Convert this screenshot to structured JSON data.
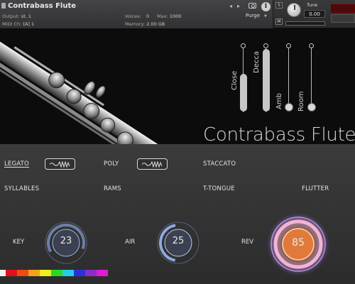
{
  "header": {
    "instrument_name": "Contrabass Flute",
    "output_label": "Output:",
    "output_value": "st. 1",
    "midi_label": "MIDI Ch:",
    "midi_value": "[A] 1",
    "voices_label": "Voices:",
    "voices_value": "0",
    "max_label": "Max:",
    "max_value": "1000",
    "memory_label": "Memory:",
    "memory_value": "2.00 GB",
    "purge_label": "Purge",
    "info_label": "i",
    "tune_label": "Tune",
    "tune_value": "0.00",
    "s_label": "S",
    "m_label": "M",
    "nav_left": "◂",
    "nav_right": "▸"
  },
  "mics": [
    {
      "name": "Close",
      "level": 0.55
    },
    {
      "name": "Decca",
      "level": 0.9
    },
    {
      "name": "Amb",
      "level": 0.0
    },
    {
      "name": "Room",
      "level": 0.0
    }
  ],
  "title": "Contrabass Flute",
  "articulations": {
    "legato": "LEGATO",
    "poly": "POLY",
    "staccato": "STACCATO",
    "syllables": "SYLLABLES",
    "rams": "RAMS",
    "ttongue": "T-TONGUE",
    "flutter": "FLUTTER"
  },
  "knobs": {
    "key": {
      "label": "KEY",
      "value": "23"
    },
    "air": {
      "label": "AIR",
      "value": "25"
    },
    "rev": {
      "label": "REV",
      "value": "85"
    }
  },
  "colors": {
    "swatches": [
      "#f2f2f2",
      "#e0111b",
      "#f04a14",
      "#f4a418",
      "#eef01c",
      "#2ad928",
      "#23cfe6",
      "#2b2fe0",
      "#8d2cc7",
      "#e21bd6"
    ],
    "accent_blue": "#8fb4f0",
    "accent_orange": "#f08a3e"
  }
}
